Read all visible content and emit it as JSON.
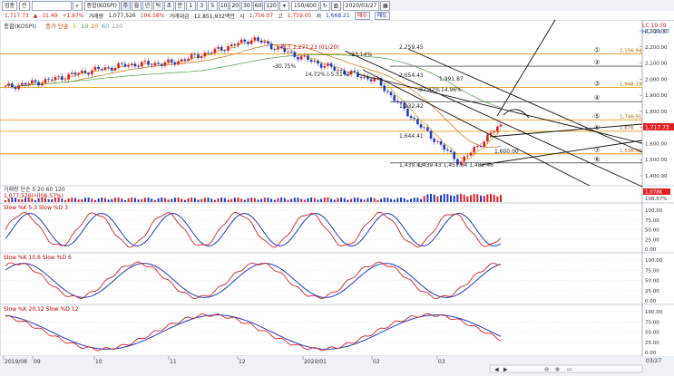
{
  "toolbar": {
    "mode": "업종",
    "market": "전",
    "indicator": "종합(KOSPI)",
    "periods": [
      "주",
      "월",
      "년",
      "틱",
      "초",
      "분",
      "1",
      "3",
      "5",
      "10",
      "20",
      "30",
      "60",
      "120"
    ],
    "zoom": "150/600",
    "date": "2020/03/27"
  },
  "quote": {
    "price": "1,717.73",
    "change_arrow": "▲",
    "change": "31.49",
    "change_pct": "+1.87%",
    "volume_label": "거래량",
    "volume": "1,077,526",
    "volume_ratio": "106.58%",
    "amount_label": "거래대금",
    "amount": "12,851,932백만",
    "high_label": "시",
    "high": "1,756.07",
    "low_label": "고",
    "low": "1,759.05",
    "close_label": "저",
    "close": "1,668.21",
    "buy_label": "매수",
    "sell_label": "매도"
  },
  "price_panel": {
    "legend": "종합(KOSPI)",
    "ma_label": "종가 단순",
    "ma_periods": [
      "5",
      "10",
      "20",
      "60",
      "120"
    ],
    "top_right": [
      "LC:19.39",
      "HC:-24.57"
    ],
    "annotations": {
      "high_label": "최고 2,277.23 (01/20)",
      "low_label": "최저 1,439.43 (03/19)",
      "pct1": "-30.75%",
      "pct2": "-23.14%",
      "pct3": "14.72%",
      "pct4": "(-5.51%)",
      "pct5": "-87.42%",
      "pct6": "14.96%",
      "lvl_2259": "2,259.45",
      "lvl_2054": "2,054.43",
      "lvl_1991": "1,991.87",
      "lvl_1932": "1,932.42",
      "lvl_1644": "1,644.41",
      "lvl_1439": "1,439.43",
      "lvl_1600": "1,600.00",
      "bottom_cluster": "1,439.43 1,457.64 1,482.46"
    },
    "h_levels": [
      {
        "num": "①",
        "value": "2,156.94"
      },
      {
        "num": "②",
        "value": ""
      },
      {
        "num": "③",
        "value": "1,948.19"
      },
      {
        "num": "④",
        "value": ""
      },
      {
        "num": "⑤",
        "value": "1,746.91"
      },
      {
        "num": "⑥",
        "value": "1,676"
      },
      {
        "num": "⑦",
        "value": "1,536.36"
      },
      {
        "num": "⑧",
        "value": ""
      }
    ],
    "y_ticks": [
      "2,300.00",
      "2,200.00",
      "2,100.00",
      "2,000.00",
      "1,900.00",
      "1,800.00",
      "1,700.00",
      "1,600.00",
      "1,500.00",
      "1,400.00"
    ],
    "last_price_tag": "1,717.73"
  },
  "volume_panel": {
    "legend": "거래량 단순 5 20 60 120",
    "value": "1,077,526(시(06.57%)",
    "tag": "1,078K",
    "tag2": "106.57%"
  },
  "stoch_panels": [
    {
      "label": "Slow %K 5,3  Slow %D 3",
      "ticks": [
        "100.00",
        "75.00",
        "50.00",
        "25.00",
        "0.00"
      ]
    },
    {
      "label": "Slow %K 10,6  Slow %D 6",
      "ticks": [
        "100.00",
        "75.00",
        "50.00",
        "25.00",
        "0.00"
      ]
    },
    {
      "label": "Slow %K 20,12  Slow %D 12",
      "ticks": [
        "100.00",
        "75.00",
        "50.00",
        "25.00",
        "0.00"
      ]
    }
  ],
  "x_axis": [
    "2019/08",
    "09",
    "10",
    "11",
    "12",
    "2020/01",
    "02",
    "03"
  ],
  "x_axis_right": "03/27",
  "colors": {
    "up": "#e02020",
    "down": "#1a3ccc",
    "ma5": "#e0a000",
    "ma20": "#d46a00",
    "ma60": "#3f9f3f",
    "hline": "#e69a1e"
  },
  "chart_data": {
    "type": "candlestick",
    "title": "종합(KOSPI)",
    "ylim": [
      1400,
      2300
    ],
    "x": [
      "2019/08",
      "09",
      "10",
      "11",
      "12",
      "2020/01",
      "02",
      "03",
      "03/27"
    ],
    "close_series": [
      1950,
      1990,
      2050,
      2090,
      2100,
      2170,
      2250,
      2150,
      2060,
      1990,
      1720,
      1480,
      1717.73
    ],
    "levels": [
      2156.94,
      1948.19,
      1746.91,
      1676,
      1536.36
    ],
    "high": 2277.23,
    "low": 1439.43,
    "last": 1717.73
  }
}
